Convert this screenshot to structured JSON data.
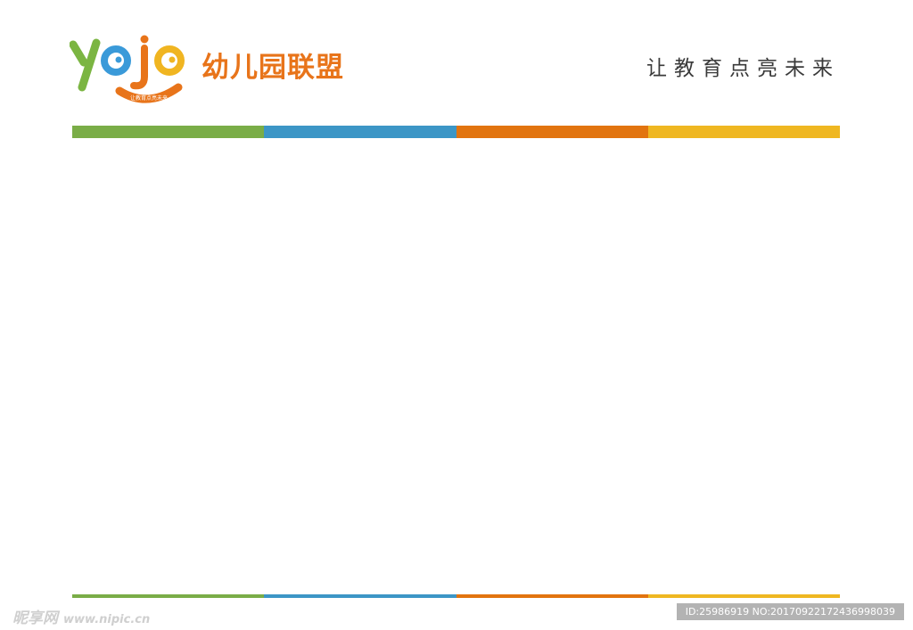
{
  "logo": {
    "letters": "yojo",
    "ribbon_text": "让教育点亮未来",
    "colors": {
      "y": "#7BB542",
      "o": "#3A9AD9",
      "j": "#E8741A",
      "o2": "#F0B521",
      "ribbon": "#E8741A"
    }
  },
  "header": {
    "brand": "幼儿园联盟",
    "slogan": "让教育点亮未来"
  },
  "stripe_colors": [
    "#7AAD47",
    "#3C96C6",
    "#E2740F",
    "#EFB721"
  ],
  "watermark": {
    "text": "昵享网",
    "url": "www.nipic.cn",
    "id": "ID:25986919 NO:20170922172436998039"
  }
}
